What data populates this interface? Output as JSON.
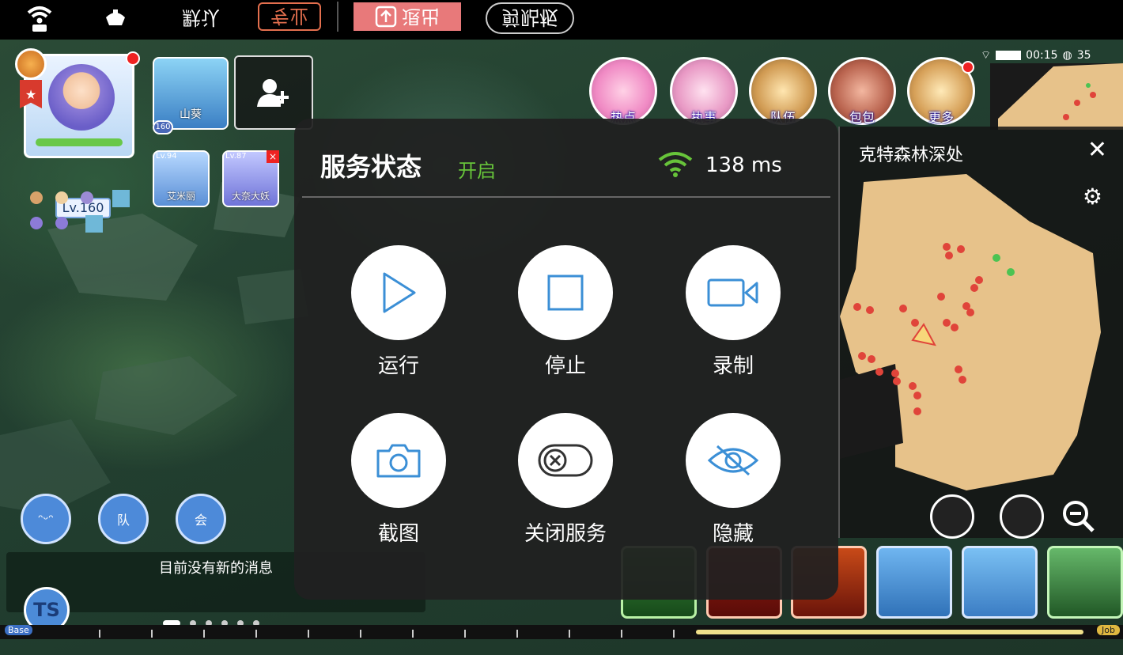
{
  "toolbar": {
    "default_label": "默认",
    "pro_label": "专业",
    "upload_label": "退出",
    "clipboard_label": "剪贴板",
    "icons": [
      "wifi-signal-icon",
      "lamp-icon",
      "upload-icon"
    ],
    "accent_color": "#e8797a"
  },
  "status_bar": {
    "time": "00:15",
    "battery_percent": "35"
  },
  "game": {
    "player": {
      "level": "Lv.160"
    },
    "party": [
      {
        "name": "山葵",
        "level": "160"
      },
      {
        "name": "艾米丽",
        "level": "Lv.94"
      },
      {
        "name": "大奈大妖",
        "level": "Lv.87"
      }
    ],
    "top_buttons": [
      {
        "label": "热点"
      },
      {
        "label": "执事"
      },
      {
        "label": "队伍"
      },
      {
        "label": "包包"
      },
      {
        "label": "更多"
      }
    ],
    "map": {
      "title": "克特森林深处",
      "close_glyph": "✕",
      "gear_glyph": "⚙"
    },
    "chat": {
      "message": "目前没有新的消息",
      "team_label": "队",
      "guild_label": "会",
      "logo_text": "TS"
    },
    "exp_bar": {
      "base_label": "Base",
      "job_label": "Job"
    }
  },
  "panel": {
    "title": "服务状态",
    "state": "开启",
    "ping": "138 ms",
    "state_color": "#67c43a",
    "icon_color": "#3b8fd6",
    "actions": [
      {
        "label": "运行",
        "icon": "play-icon"
      },
      {
        "label": "停止",
        "icon": "stop-icon"
      },
      {
        "label": "录制",
        "icon": "video-camera-icon"
      },
      {
        "label": "截图",
        "icon": "camera-icon"
      },
      {
        "label": "关闭服务",
        "icon": "toggle-off-icon"
      },
      {
        "label": "隐藏",
        "icon": "eye-slash-icon"
      }
    ]
  }
}
